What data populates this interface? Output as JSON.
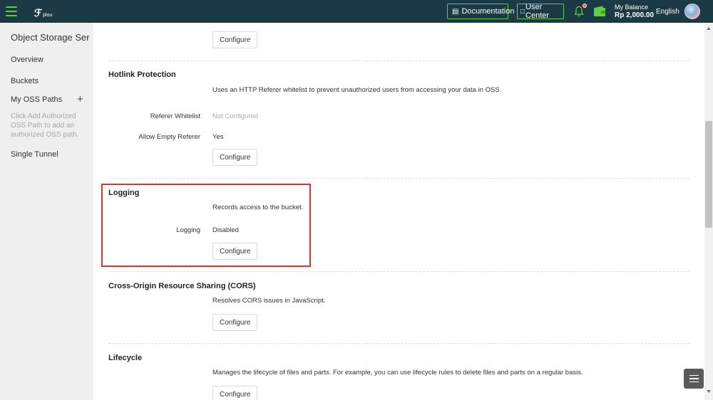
{
  "topbar": {
    "logo_text": "plou",
    "documentation_label": "Documentation",
    "user_center_label": "User Center",
    "balance_label": "My Balance",
    "balance_amount": "Rp 2,000.00",
    "language": "English",
    "icons": {
      "menu": "hamburger-menu-icon",
      "docs": "document-icon",
      "uc": "monitor-icon",
      "bell": "bell-icon",
      "wallet": "wallet-icon"
    },
    "accent_color": "#5fcf3f",
    "bg_color": "#1b3a45"
  },
  "sidebar": {
    "title": "Object Storage Ser...",
    "items": [
      "Overview",
      "Buckets",
      "My OSS Paths",
      "Single Tunnel"
    ],
    "add_symbol": "+",
    "hint": "Click Add Authorized OSS Path to add an authorized OSS path."
  },
  "main": {
    "top_configure": "Configure",
    "hotlink": {
      "title": "Hotlink Protection",
      "description": "Uses an HTTP Referer whitelist to prevent unauthorized users from accessing your data in OSS.",
      "referer_label": "Referer Whitelist",
      "referer_value": "Not Configured",
      "empty_label": "Allow Empty Referer",
      "empty_value": "Yes",
      "configure": "Configure"
    },
    "logging": {
      "title": "Logging",
      "description": "Records access to the bucket.",
      "label": "Logging",
      "value": "Disabled",
      "configure": "Configure"
    },
    "cors": {
      "title": "Cross-Origin Resource Sharing (CORS)",
      "description": "Resolves CORS issues in JavaScript.",
      "configure": "Configure"
    },
    "lifecycle": {
      "title": "Lifecycle",
      "description": "Manages the lifecycle of files and parts. For example, you can use lifecycle rules to delete files and parts on a regular basis.",
      "configure": "Configure"
    },
    "highlight_color": "#e03030"
  }
}
